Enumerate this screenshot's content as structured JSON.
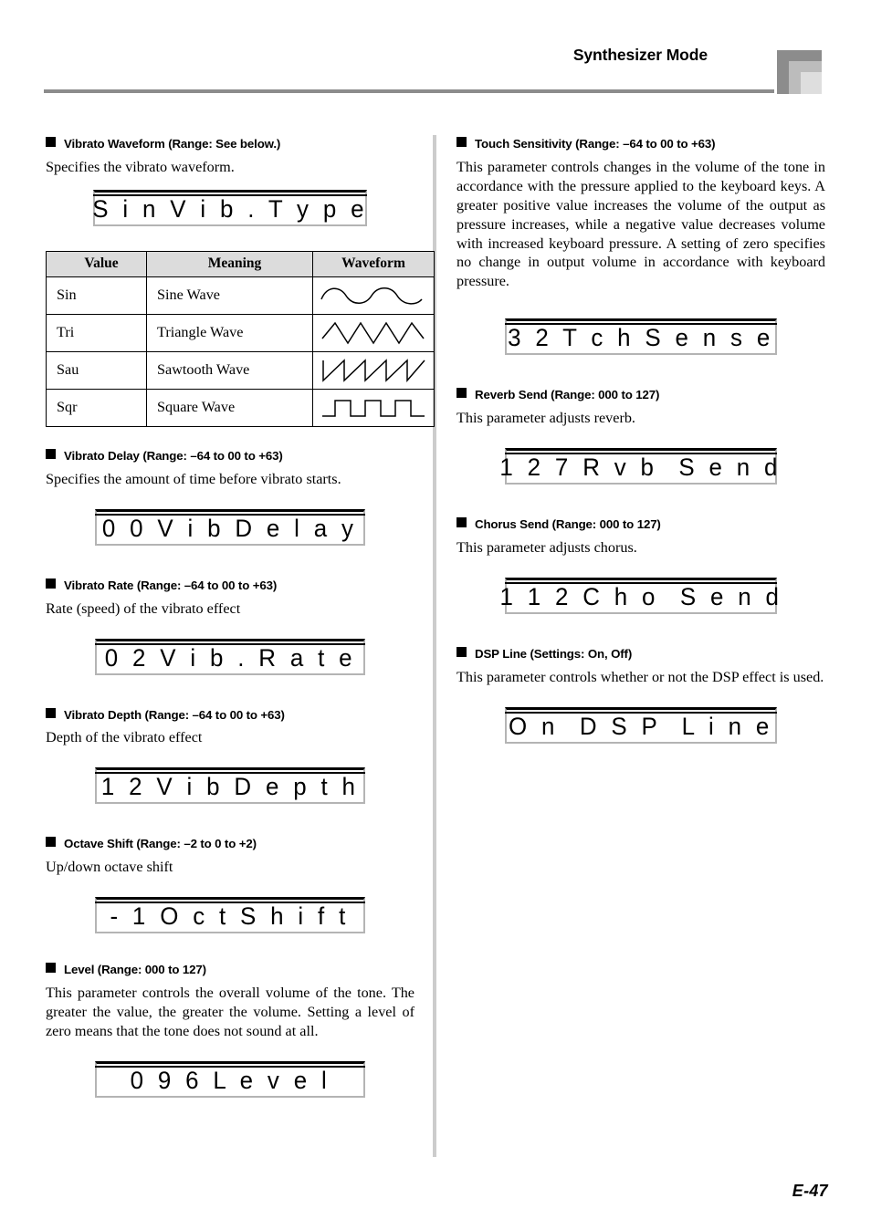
{
  "header": {
    "title": "Synthesizer Mode"
  },
  "footer": {
    "page_number": "E-47"
  },
  "left_column": {
    "sections": [
      {
        "heading": "Vibrato Waveform (Range: See below.)",
        "body": "Specifies the vibrato waveform.",
        "lcd": "S i n V i b . T y p e"
      },
      {
        "heading": "Vibrato Delay (Range: –64 to 00 to +63)",
        "body": "Specifies the amount of time before vibrato starts.",
        "lcd": "0 0 V i b D e l a y"
      },
      {
        "heading": "Vibrato Rate (Range: –64 to 00 to +63)",
        "body": "Rate (speed) of the vibrato effect",
        "lcd": "0 2 V i b . R a t e"
      },
      {
        "heading": "Vibrato Depth (Range: –64 to 00 to +63)",
        "body": "Depth of the vibrato effect",
        "lcd": "1 2 V i b D e p t h"
      },
      {
        "heading": "Octave Shift (Range: –2 to 0 to +2)",
        "body": "Up/down octave shift",
        "lcd": "- 1 O c t S h i f t"
      },
      {
        "heading": "Level (Range: 000 to 127)",
        "body": "This parameter controls the overall volume of the tone. The greater the value, the greater the volume. Setting a level of zero means that the tone does not sound at all.",
        "lcd": "0 9 6 L e v e l"
      }
    ]
  },
  "right_column": {
    "sections": [
      {
        "heading": "Touch Sensitivity (Range: –64 to 00 to +63)",
        "body": "This parameter controls changes in the volume of the tone in accordance with the pressure applied to the keyboard keys. A greater positive value increases the volume of the output as pressure increases, while a negative value decreases volume with increased keyboard pressure. A setting of zero specifies no change in output volume in accordance with keyboard pressure.",
        "lcd": "3 2 T c h S e n s e"
      },
      {
        "heading": "Reverb Send (Range: 000 to 127)",
        "body": "This parameter adjusts reverb.",
        "lcd": "1 2 7 R v b  S e n d"
      },
      {
        "heading": "Chorus Send (Range: 000 to 127)",
        "body": "This parameter adjusts chorus.",
        "lcd": "1 1 2 C h o  S e n d"
      },
      {
        "heading": "DSP Line (Settings: On, Off)",
        "body": "This parameter controls whether or not the DSP effect is used.",
        "lcd": "O n  D S P  L i n e"
      }
    ]
  },
  "waveform_table": {
    "columns": [
      "Value",
      "Meaning",
      "Waveform"
    ],
    "rows": [
      {
        "value": "Sin",
        "meaning": "Sine Wave",
        "waveform": "sine-wave-icon"
      },
      {
        "value": "Tri",
        "meaning": "Triangle Wave",
        "waveform": "triangle-wave-icon"
      },
      {
        "value": "Sau",
        "meaning": "Sawtooth Wave",
        "waveform": "sawtooth-wave-icon"
      },
      {
        "value": "Sqr",
        "meaning": "Square Wave",
        "waveform": "square-wave-icon"
      }
    ]
  },
  "colors": {
    "header_rule": "#8c8c8c",
    "corner_dark": "#8c8c8c",
    "corner_mid": "#bcbcbc",
    "corner_light": "#dedede",
    "divider": "#cccccc",
    "table_header_fill": "#dcdcdc",
    "lcd_border": "#b4b4b4"
  }
}
